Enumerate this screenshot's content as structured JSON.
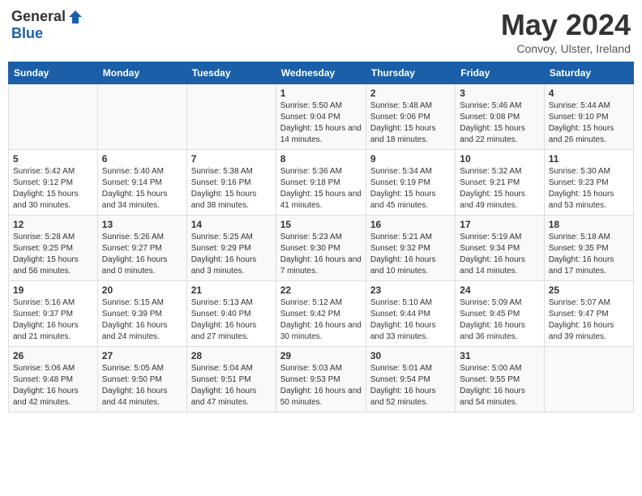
{
  "header": {
    "logo_general": "General",
    "logo_blue": "Blue",
    "title": "May 2024",
    "location": "Convoy, Ulster, Ireland"
  },
  "days_of_week": [
    "Sunday",
    "Monday",
    "Tuesday",
    "Wednesday",
    "Thursday",
    "Friday",
    "Saturday"
  ],
  "weeks": [
    [
      {
        "day": "",
        "info": ""
      },
      {
        "day": "",
        "info": ""
      },
      {
        "day": "",
        "info": ""
      },
      {
        "day": "1",
        "info": "Sunrise: 5:50 AM\nSunset: 9:04 PM\nDaylight: 15 hours and 14 minutes."
      },
      {
        "day": "2",
        "info": "Sunrise: 5:48 AM\nSunset: 9:06 PM\nDaylight: 15 hours and 18 minutes."
      },
      {
        "day": "3",
        "info": "Sunrise: 5:46 AM\nSunset: 9:08 PM\nDaylight: 15 hours and 22 minutes."
      },
      {
        "day": "4",
        "info": "Sunrise: 5:44 AM\nSunset: 9:10 PM\nDaylight: 15 hours and 26 minutes."
      }
    ],
    [
      {
        "day": "5",
        "info": "Sunrise: 5:42 AM\nSunset: 9:12 PM\nDaylight: 15 hours and 30 minutes."
      },
      {
        "day": "6",
        "info": "Sunrise: 5:40 AM\nSunset: 9:14 PM\nDaylight: 15 hours and 34 minutes."
      },
      {
        "day": "7",
        "info": "Sunrise: 5:38 AM\nSunset: 9:16 PM\nDaylight: 15 hours and 38 minutes."
      },
      {
        "day": "8",
        "info": "Sunrise: 5:36 AM\nSunset: 9:18 PM\nDaylight: 15 hours and 41 minutes."
      },
      {
        "day": "9",
        "info": "Sunrise: 5:34 AM\nSunset: 9:19 PM\nDaylight: 15 hours and 45 minutes."
      },
      {
        "day": "10",
        "info": "Sunrise: 5:32 AM\nSunset: 9:21 PM\nDaylight: 15 hours and 49 minutes."
      },
      {
        "day": "11",
        "info": "Sunrise: 5:30 AM\nSunset: 9:23 PM\nDaylight: 15 hours and 53 minutes."
      }
    ],
    [
      {
        "day": "12",
        "info": "Sunrise: 5:28 AM\nSunset: 9:25 PM\nDaylight: 15 hours and 56 minutes."
      },
      {
        "day": "13",
        "info": "Sunrise: 5:26 AM\nSunset: 9:27 PM\nDaylight: 16 hours and 0 minutes."
      },
      {
        "day": "14",
        "info": "Sunrise: 5:25 AM\nSunset: 9:29 PM\nDaylight: 16 hours and 3 minutes."
      },
      {
        "day": "15",
        "info": "Sunrise: 5:23 AM\nSunset: 9:30 PM\nDaylight: 16 hours and 7 minutes."
      },
      {
        "day": "16",
        "info": "Sunrise: 5:21 AM\nSunset: 9:32 PM\nDaylight: 16 hours and 10 minutes."
      },
      {
        "day": "17",
        "info": "Sunrise: 5:19 AM\nSunset: 9:34 PM\nDaylight: 16 hours and 14 minutes."
      },
      {
        "day": "18",
        "info": "Sunrise: 5:18 AM\nSunset: 9:35 PM\nDaylight: 16 hours and 17 minutes."
      }
    ],
    [
      {
        "day": "19",
        "info": "Sunrise: 5:16 AM\nSunset: 9:37 PM\nDaylight: 16 hours and 21 minutes."
      },
      {
        "day": "20",
        "info": "Sunrise: 5:15 AM\nSunset: 9:39 PM\nDaylight: 16 hours and 24 minutes."
      },
      {
        "day": "21",
        "info": "Sunrise: 5:13 AM\nSunset: 9:40 PM\nDaylight: 16 hours and 27 minutes."
      },
      {
        "day": "22",
        "info": "Sunrise: 5:12 AM\nSunset: 9:42 PM\nDaylight: 16 hours and 30 minutes."
      },
      {
        "day": "23",
        "info": "Sunrise: 5:10 AM\nSunset: 9:44 PM\nDaylight: 16 hours and 33 minutes."
      },
      {
        "day": "24",
        "info": "Sunrise: 5:09 AM\nSunset: 9:45 PM\nDaylight: 16 hours and 36 minutes."
      },
      {
        "day": "25",
        "info": "Sunrise: 5:07 AM\nSunset: 9:47 PM\nDaylight: 16 hours and 39 minutes."
      }
    ],
    [
      {
        "day": "26",
        "info": "Sunrise: 5:06 AM\nSunset: 9:48 PM\nDaylight: 16 hours and 42 minutes."
      },
      {
        "day": "27",
        "info": "Sunrise: 5:05 AM\nSunset: 9:50 PM\nDaylight: 16 hours and 44 minutes."
      },
      {
        "day": "28",
        "info": "Sunrise: 5:04 AM\nSunset: 9:51 PM\nDaylight: 16 hours and 47 minutes."
      },
      {
        "day": "29",
        "info": "Sunrise: 5:03 AM\nSunset: 9:53 PM\nDaylight: 16 hours and 50 minutes."
      },
      {
        "day": "30",
        "info": "Sunrise: 5:01 AM\nSunset: 9:54 PM\nDaylight: 16 hours and 52 minutes."
      },
      {
        "day": "31",
        "info": "Sunrise: 5:00 AM\nSunset: 9:55 PM\nDaylight: 16 hours and 54 minutes."
      },
      {
        "day": "",
        "info": ""
      }
    ]
  ]
}
